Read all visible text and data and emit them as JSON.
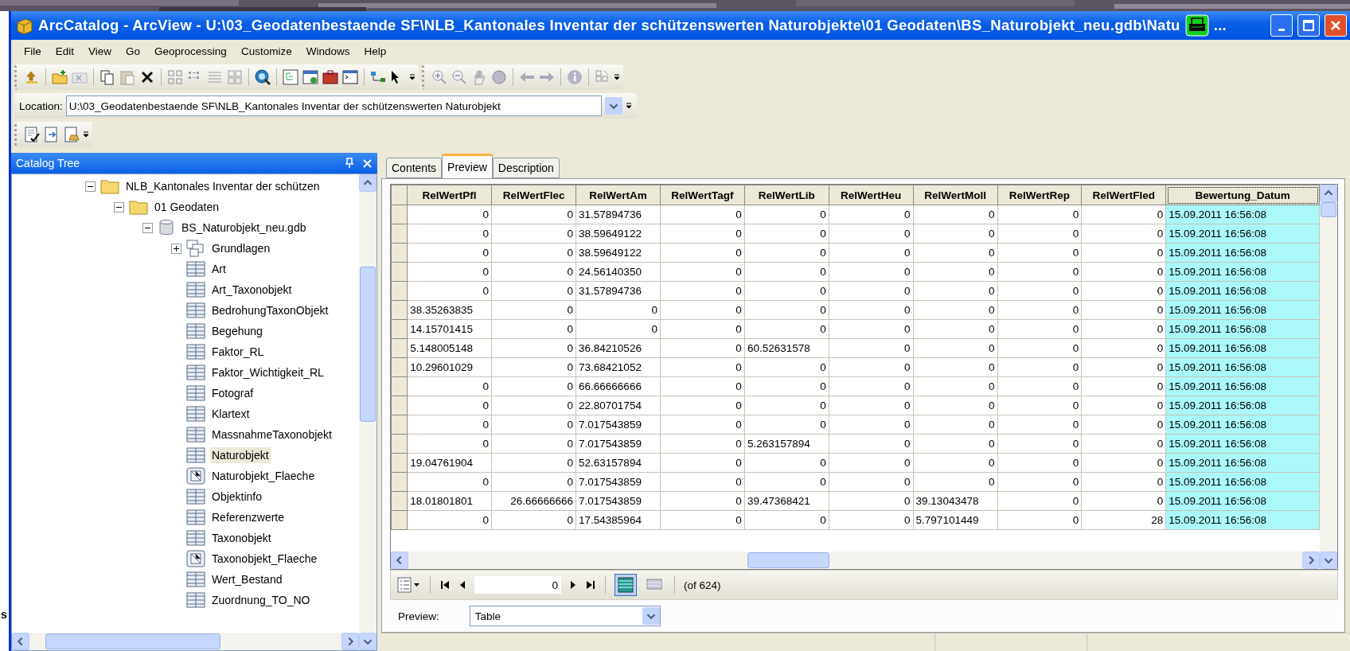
{
  "desktop": {
    "edge_text": "s"
  },
  "window": {
    "title": "ArcCatalog - ArcView - U:\\03_Geodatenbestaende SF\\NLB_Kantonales Inventar der schützenswerten Naturobjekte\\01 Geodaten\\BS_Naturobjekt_neu.gdb\\Natu",
    "title_ellipsis": "..."
  },
  "menu": [
    "File",
    "Edit",
    "View",
    "Go",
    "Geoprocessing",
    "Customize",
    "Windows",
    "Help"
  ],
  "location": {
    "label": "Location:",
    "value": "U:\\03_Geodatenbestaende SF\\NLB_Kantonales Inventar der schützenswerten Naturobjekt"
  },
  "catalog_tree": {
    "title": "Catalog Tree",
    "items": [
      {
        "label": "NLB_Kantonales Inventar der schützen",
        "kind": "folder",
        "expanded": true,
        "selected": false,
        "children": [
          {
            "label": "01 Geodaten",
            "kind": "folder",
            "expanded": true,
            "selected": false,
            "children": [
              {
                "label": "BS_Naturobjekt_neu.gdb",
                "kind": "database",
                "expanded": true,
                "selected": false,
                "children": [
                  {
                    "label": "Grundlagen",
                    "kind": "dataset",
                    "expanded": false,
                    "selected": false
                  },
                  {
                    "label": "Art",
                    "kind": "table",
                    "selected": false
                  },
                  {
                    "label": "Art_Taxonobjekt",
                    "kind": "table",
                    "selected": false
                  },
                  {
                    "label": "BedrohungTaxonObjekt",
                    "kind": "table",
                    "selected": false
                  },
                  {
                    "label": "Begehung",
                    "kind": "table",
                    "selected": false
                  },
                  {
                    "label": "Faktor_RL",
                    "kind": "table",
                    "selected": false
                  },
                  {
                    "label": "Faktor_Wichtigkeit_RL",
                    "kind": "table",
                    "selected": false
                  },
                  {
                    "label": "Fotograf",
                    "kind": "table",
                    "selected": false
                  },
                  {
                    "label": "Klartext",
                    "kind": "table",
                    "selected": false
                  },
                  {
                    "label": "MassnahmeTaxonobjekt",
                    "kind": "table",
                    "selected": false
                  },
                  {
                    "label": "Naturobjekt",
                    "kind": "table",
                    "selected": true
                  },
                  {
                    "label": "Naturobjekt_Flaeche",
                    "kind": "polygon",
                    "selected": false
                  },
                  {
                    "label": "Objektinfo",
                    "kind": "table",
                    "selected": false
                  },
                  {
                    "label": "Referenzwerte",
                    "kind": "table",
                    "selected": false
                  },
                  {
                    "label": "Taxonobjekt",
                    "kind": "table",
                    "selected": false
                  },
                  {
                    "label": "Taxonobjekt_Flaeche",
                    "kind": "polygon",
                    "selected": false
                  },
                  {
                    "label": "Wert_Bestand",
                    "kind": "table",
                    "selected": false
                  },
                  {
                    "label": "Zuordnung_TO_NO",
                    "kind": "table",
                    "selected": false
                  }
                ]
              }
            ]
          }
        ]
      }
    ]
  },
  "tabs": [
    {
      "label": "Contents",
      "selected": false
    },
    {
      "label": "Preview",
      "selected": true
    },
    {
      "label": "Description",
      "selected": false
    }
  ],
  "table": {
    "columns": [
      {
        "label": "RelWertPfl",
        "selected": false
      },
      {
        "label": "RelWertFlec",
        "selected": false
      },
      {
        "label": "RelWertAm",
        "selected": false
      },
      {
        "label": "RelWertTagf",
        "selected": false
      },
      {
        "label": "RelWertLib",
        "selected": false
      },
      {
        "label": "RelWertHeu",
        "selected": false
      },
      {
        "label": "RelWertMoll",
        "selected": false
      },
      {
        "label": "RelWertRep",
        "selected": false
      },
      {
        "label": "RelWertFled",
        "selected": false
      },
      {
        "label": "Bewertung_Datum",
        "selected": true
      }
    ],
    "rows": [
      [
        "0",
        "0",
        "31.57894736",
        "0",
        "0",
        "0",
        "0",
        "0",
        "0",
        "15.09.2011 16:56:08"
      ],
      [
        "0",
        "0",
        "38.59649122",
        "0",
        "0",
        "0",
        "0",
        "0",
        "0",
        "15.09.2011 16:56:08"
      ],
      [
        "0",
        "0",
        "38.59649122",
        "0",
        "0",
        "0",
        "0",
        "0",
        "0",
        "15.09.2011 16:56:08"
      ],
      [
        "0",
        "0",
        "24.56140350",
        "0",
        "0",
        "0",
        "0",
        "0",
        "0",
        "15.09.2011 16:56:08"
      ],
      [
        "0",
        "0",
        "31.57894736",
        "0",
        "0",
        "0",
        "0",
        "0",
        "0",
        "15.09.2011 16:56:08"
      ],
      [
        "38.35263835",
        "0",
        "0",
        "0",
        "0",
        "0",
        "0",
        "0",
        "0",
        "15.09.2011 16:56:08"
      ],
      [
        "14.15701415",
        "0",
        "0",
        "0",
        "0",
        "0",
        "0",
        "0",
        "0",
        "15.09.2011 16:56:08"
      ],
      [
        "5.148005148",
        "0",
        "36.84210526",
        "0",
        "60.52631578",
        "0",
        "0",
        "0",
        "0",
        "15.09.2011 16:56:08"
      ],
      [
        "10.29601029",
        "0",
        "73.68421052",
        "0",
        "0",
        "0",
        "0",
        "0",
        "0",
        "15.09.2011 16:56:08"
      ],
      [
        "0",
        "0",
        "66.66666666",
        "0",
        "0",
        "0",
        "0",
        "0",
        "0",
        "15.09.2011 16:56:08"
      ],
      [
        "0",
        "0",
        "22.80701754",
        "0",
        "0",
        "0",
        "0",
        "0",
        "0",
        "15.09.2011 16:56:08"
      ],
      [
        "0",
        "0",
        "7.017543859",
        "0",
        "0",
        "0",
        "0",
        "0",
        "0",
        "15.09.2011 16:56:08"
      ],
      [
        "0",
        "0",
        "7.017543859",
        "0",
        "5.263157894",
        "0",
        "0",
        "0",
        "0",
        "15.09.2011 16:56:08"
      ],
      [
        "19.04761904",
        "0",
        "52.63157894",
        "0",
        "0",
        "0",
        "0",
        "0",
        "0",
        "15.09.2011 16:56:08"
      ],
      [
        "0",
        "0",
        "7.017543859",
        "0",
        "0",
        "0",
        "0",
        "0",
        "0",
        "15.09.2011 16:56:08"
      ],
      [
        "18.01801801",
        "26.66666666",
        "7.017543859",
        "0",
        "39.47368421",
        "0",
        "39.13043478",
        "0",
        "0",
        "15.09.2011 16:56:08"
      ],
      [
        "0",
        "0",
        "17.54385964",
        "0",
        "0",
        "0",
        "5.797101449",
        "0",
        "28",
        "15.09.2011 16:56:08"
      ]
    ]
  },
  "navigator": {
    "record": "0",
    "count": "(of 624)",
    "views": [
      {
        "selected": true
      },
      {
        "selected": false
      }
    ]
  },
  "preview": {
    "label": "Preview:",
    "value": "Table"
  }
}
